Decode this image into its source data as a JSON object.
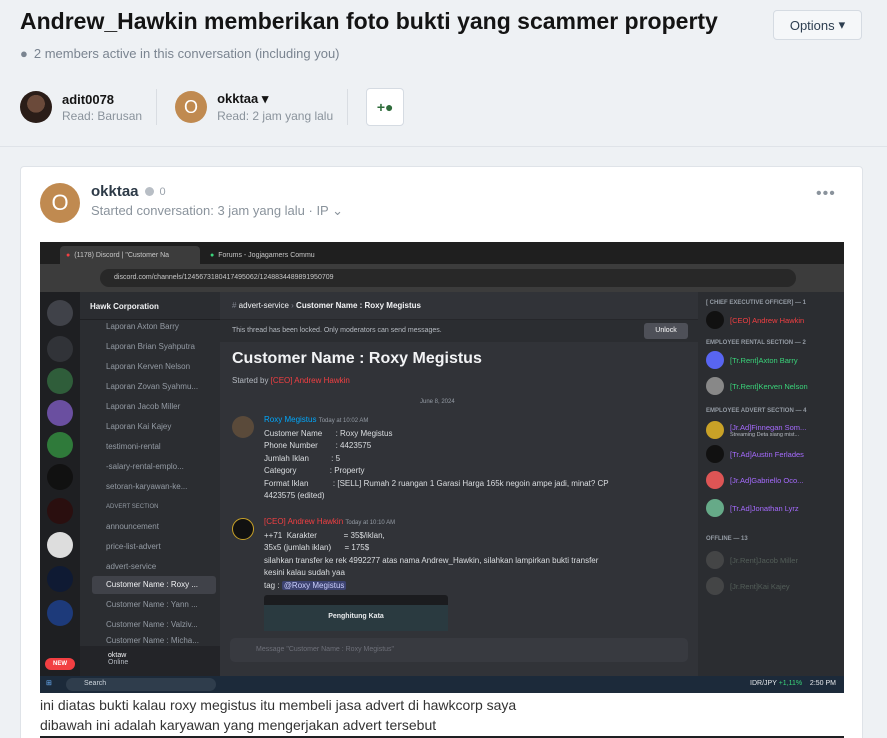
{
  "thread": {
    "title": "Andrew_Hawkin memberikan foto bukti yang scammer property",
    "options_label": "Options",
    "members_active": "2 members active in this conversation (including you)"
  },
  "participants": [
    {
      "name": "adit0078",
      "read": "Read: Barusan"
    },
    {
      "name": "okktaa",
      "read": "Read: 2 jam yang lalu"
    }
  ],
  "post": {
    "author_initial": "O",
    "author": "okktaa",
    "badge_count": "0",
    "meta": "Started conversation: 3 jam yang lalu · IP",
    "caption_1": "ini diatas bukti kalau roxy megistus itu membeli jasa advert di hawkcorp saya",
    "caption_2": "dibawah ini adalah karyawan yang mengerjakan advert tersebut"
  },
  "screenshot": {
    "tabs": [
      "(1178) Discord | \"Customer Na",
      "Forums - Jogjagamers Commu"
    ],
    "url": "discord.com/channels/1245673180417495062/1248834489891950709",
    "guild": "Hawk Corporation",
    "channels": [
      "Laporan Axton Barry",
      "Laporan Brian Syahputra",
      "Laporan Kerven Nelson",
      "Laporan Zovan Syahmu...",
      "Laporan Jacob Miller",
      "Laporan Kai Kajey",
      "testimoni-rental",
      "-salary-rental-emplo...",
      "setoran-karyawan-ke...",
      "ADVERT SECTION",
      "announcement",
      "price-list-advert",
      "advert-service",
      "Customer Name : Roxy ...",
      "Customer Name : Yann ...",
      "Customer Name : Valziv...",
      "Customer Name : Micha..."
    ],
    "user_name": "oktaw",
    "user_status": "Online",
    "channel_path": "advert-service",
    "thread_name": "Customer Name : Roxy Megistus",
    "search_placeholder": "Search",
    "locked_notice": "This thread has been locked. Only moderators can send messages.",
    "unlock_label": "Unlock",
    "thread_title": "Customer Name : Roxy Megistus",
    "started_by_label": "Started by",
    "started_by_name": "[CEO] Andrew Hawkin",
    "date_separator": "June 8, 2024",
    "msg1": {
      "author": "Roxy Megistus",
      "time": "Today at 10:02 AM",
      "lines": [
        "Customer Name      : Roxy Megistus",
        "Phone Number        : 4423575",
        "Jumlah Iklan          : 5",
        "Category               : Property",
        "Format Iklan           : [SELL] Rumah 2 ruangan 1 Garasi Harga 165k negoin ampe jadi, minat? CP",
        "4423575 (edited)"
      ]
    },
    "msg2": {
      "author": "[CEO] Andrew Hawkin",
      "time": "Today at 10:10 AM",
      "lines": [
        "++71  Karakter            = 35$/iklan,",
        "35x5 (jumlah iklan)      = 175$",
        "silahkan transfer ke rek 4992277 atas nama Andrew_Hawkin, silahkan lampirkan bukti transfer",
        "kesini kalau sudah yaa"
      ],
      "tag_label": "tag :",
      "tag_mention": "@Roxy Megistus",
      "embed_title": "Penghitung Kata"
    },
    "compose_placeholder": "Message \"Customer Name : Roxy Megistus\"",
    "member_groups": [
      {
        "label": "[ CHIEF EXECUTIVE OFFICER] — 1",
        "members": [
          {
            "name": "[CEO] Andrew Hawkin",
            "color": "#f23f42"
          }
        ]
      },
      {
        "label": "EMPLOYEE RENTAL SECTION — 2",
        "members": [
          {
            "name": "[Tr.Rent]Axton Barry",
            "color": "#3ad47a"
          },
          {
            "name": "[Tr.Rent]Kerven Nelson",
            "color": "#3ad47a"
          }
        ]
      },
      {
        "label": "EMPLOYEE ADVERT SECTION — 4",
        "members": [
          {
            "name": "[Jr.Ad]Finnegan Som...",
            "color": "#a66bff"
          },
          {
            "name": "[Tr.Ad]Austin Ferlades",
            "color": "#a66bff"
          },
          {
            "name": "[Jr.Ad]Gabriello Oco...",
            "color": "#a66bff"
          },
          {
            "name": "[Tr.Ad]Jonathan Lyrz",
            "color": "#a66bff"
          }
        ]
      },
      {
        "label": "OFFLINE — 13",
        "members": [
          {
            "name": "[Jr.Rent]Jacob Miller",
            "color": "#6d7d72"
          },
          {
            "name": "[Jr.Rent]Kai Kajey",
            "color": "#6d7d72"
          }
        ]
      }
    ],
    "streaming_note": "Streaming Deta siang mist...",
    "taskbar_search": "Search",
    "currency": "IDR/JPY",
    "currency_change": "+1,11%",
    "clock": "2:50 PM",
    "new_badge": "NEW"
  }
}
